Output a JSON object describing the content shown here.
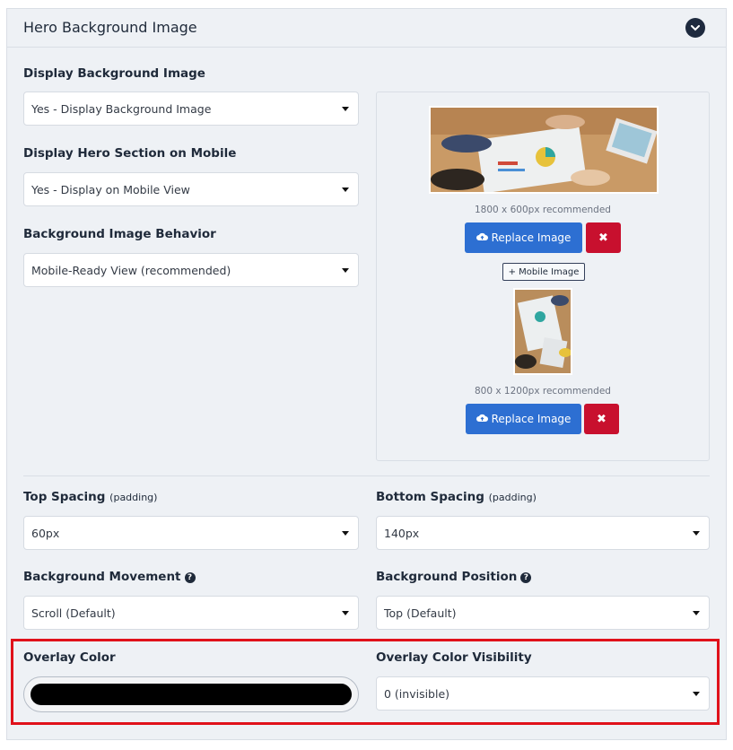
{
  "panel": {
    "title": "Hero Background Image",
    "collapse_icon": "chevron-down-icon"
  },
  "fields": {
    "display_bg": {
      "label": "Display Background Image",
      "value": "Yes - Display Background Image"
    },
    "display_mobile": {
      "label": "Display Hero Section on Mobile",
      "value": "Yes - Display on Mobile View"
    },
    "bg_behavior": {
      "label": "Background Image Behavior",
      "value": "Mobile-Ready View (recommended)"
    },
    "top_spacing": {
      "label": "Top Spacing",
      "sublabel": "(padding)",
      "value": "60px"
    },
    "bottom_spacing": {
      "label": "Bottom Spacing",
      "sublabel": "(padding)",
      "value": "140px"
    },
    "bg_movement": {
      "label": "Background Movement",
      "help_icon": "question-circle-icon",
      "value": "Scroll (Default)"
    },
    "bg_position": {
      "label": "Background Position",
      "help_icon": "question-circle-icon",
      "value": "Top (Default)"
    },
    "overlay_color": {
      "label": "Overlay Color",
      "color": "#000000"
    },
    "overlay_visibility": {
      "label": "Overlay Color Visibility",
      "value": "0 (invisible)"
    }
  },
  "images": {
    "desktop": {
      "caption": "1800 x 600px recommended",
      "replace_label": "Replace Image",
      "upload_icon": "cloud-upload-icon",
      "delete_icon": "close-icon",
      "delete_glyph": "✖"
    },
    "mobile_button_label": "+ Mobile Image",
    "mobile": {
      "caption": "800 x 1200px recommended",
      "replace_label": "Replace Image",
      "upload_icon": "cloud-upload-icon",
      "delete_icon": "close-icon",
      "delete_glyph": "✖"
    }
  },
  "colors": {
    "primary": "#2d6fd2",
    "danger": "#c8102e",
    "highlight": "#e0111a",
    "panel_bg": "#eef1f5"
  }
}
